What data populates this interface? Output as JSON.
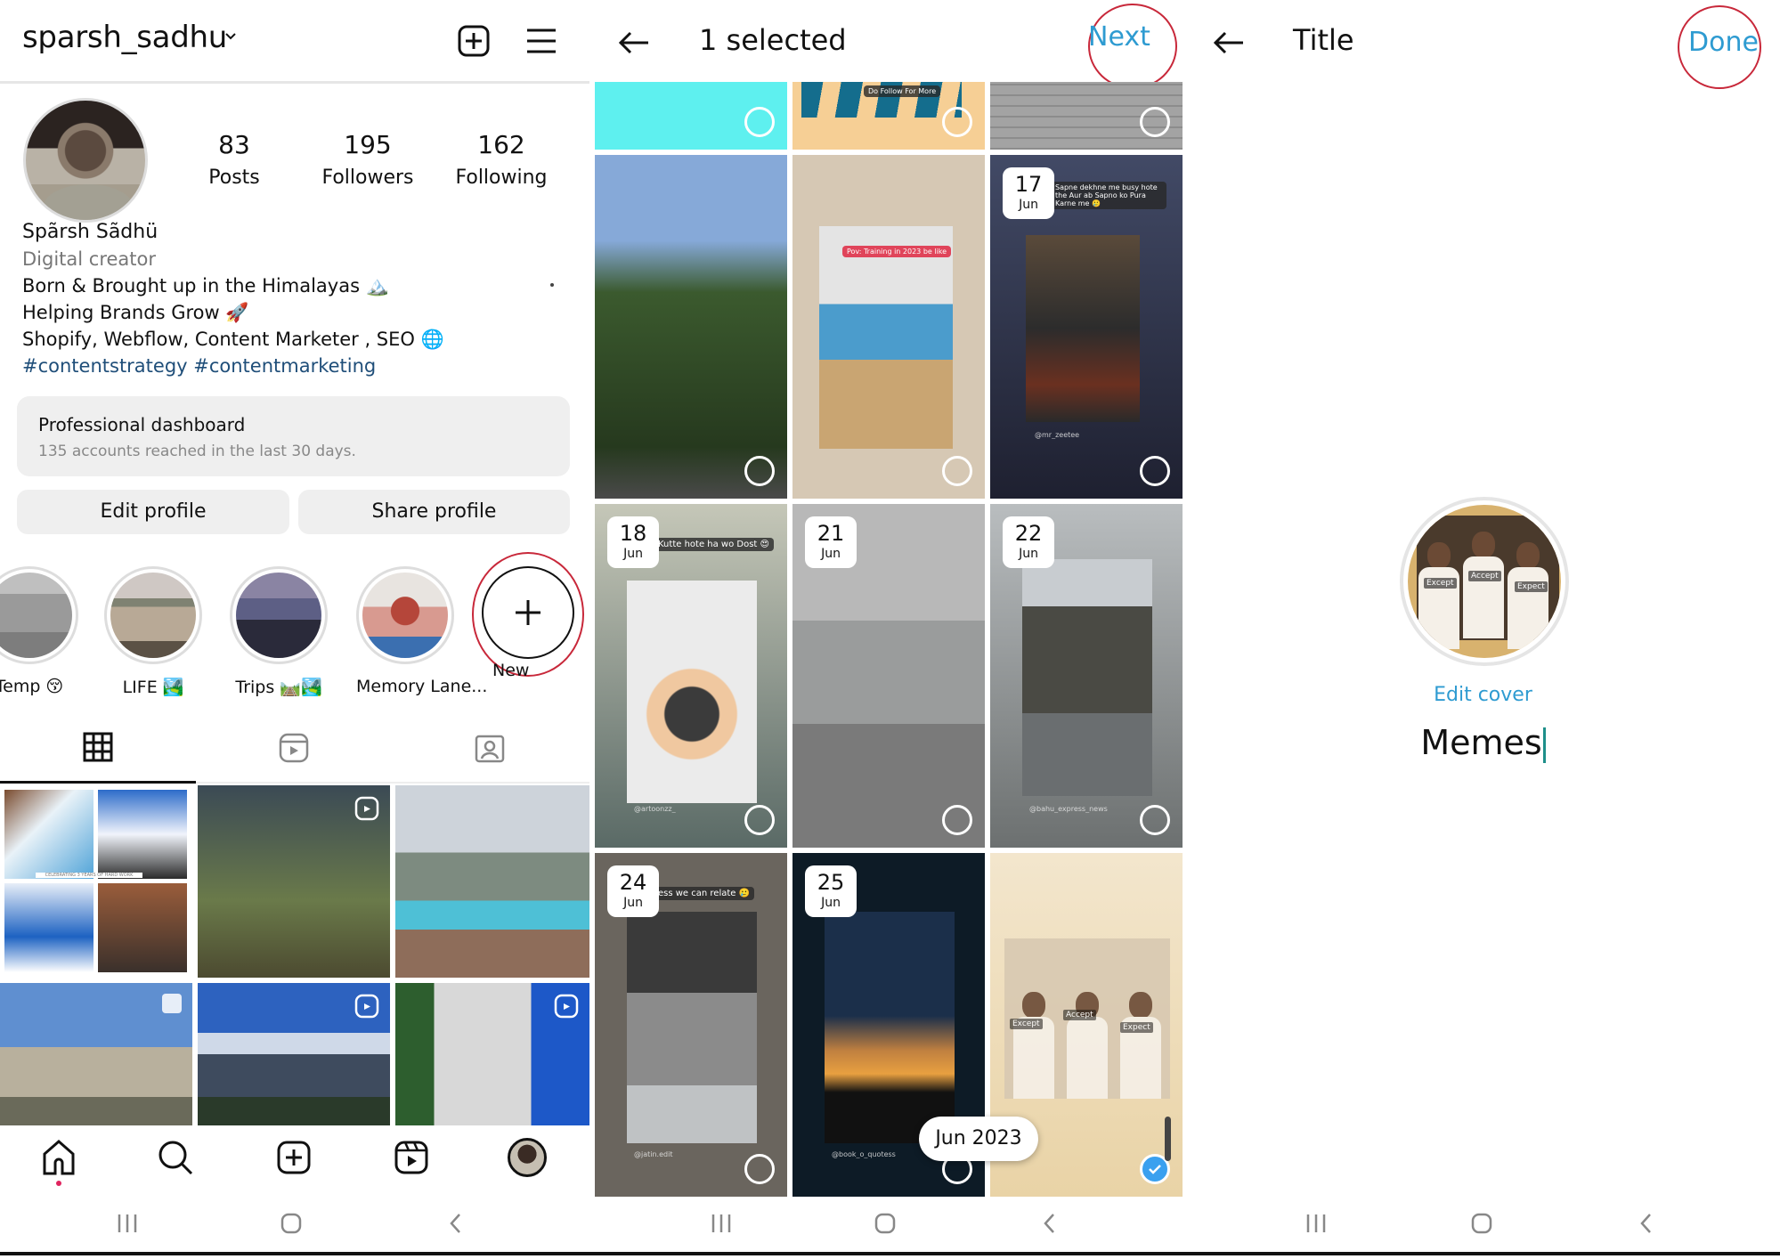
{
  "profile_screen": {
    "username": "sparsh_sadhu",
    "stats": [
      {
        "value": "83",
        "label": "Posts"
      },
      {
        "value": "195",
        "label": "Followers"
      },
      {
        "value": "162",
        "label": "Following"
      }
    ],
    "display_name": "Spãrsh Sãdhü",
    "category": "Digital creator",
    "bio_lines": [
      "Born & Brought up in the Himalayas 🏔️",
      "Helping Brands Grow 🚀",
      "Shopify, Webflow, Content Marketer , SEO 🌐"
    ],
    "hashtags": "#contentstrategy #contentmarketing",
    "dashboard": {
      "title": "Professional dashboard",
      "subtitle": "135 accounts reached in the last 30 days."
    },
    "buttons": {
      "edit": "Edit profile",
      "share": "Share profile"
    },
    "highlights": [
      {
        "label": "Temp 😚"
      },
      {
        "label": "LIFE 🏞️"
      },
      {
        "label": "Trips 🛤️🏞️"
      },
      {
        "label": "Memory Lane..."
      },
      {
        "label": "New"
      }
    ],
    "tabs": [
      "grid-icon",
      "reels-icon",
      "tagged-icon"
    ],
    "posts": [
      {
        "type": "collage",
        "caption": "CELEBRATING 3 YEARS OF HARD WORK"
      },
      {
        "type": "reel"
      },
      {
        "type": "photo"
      },
      {
        "type": "carousel"
      },
      {
        "type": "reel"
      },
      {
        "type": "reel"
      }
    ],
    "bottom_nav": [
      "home-icon",
      "search-icon",
      "create-icon",
      "reels-icon",
      "profile-avatar"
    ]
  },
  "select_screen": {
    "title": "1 selected",
    "next_label": "Next",
    "stories": [
      {
        "date_day": "",
        "date_month": "",
        "caption": "",
        "selected": false
      },
      {
        "date_day": "",
        "date_month": "",
        "caption": "Do Follow For More",
        "selected": false
      },
      {
        "date_day": "",
        "date_month": "",
        "caption": "",
        "selected": false
      },
      {
        "date_day": "",
        "date_month": "",
        "caption": "",
        "selected": false
      },
      {
        "date_day": "",
        "date_month": "",
        "caption": "Pov: Training in 2023 be like",
        "selected": false
      },
      {
        "date_day": "17",
        "date_month": "Jun",
        "caption": "Sapne dekhne me busy hote the Aur ab Sapno ko Pura Karne me 🥲",
        "handle": "@mr_zeetee",
        "selected": false
      },
      {
        "date_day": "18",
        "date_month": "Jun",
        "caption": "Kutte hote ha wo Dost 😍",
        "handle": "@artoonzz_",
        "selected": false
      },
      {
        "date_day": "21",
        "date_month": "Jun",
        "caption": "",
        "selected": false
      },
      {
        "date_day": "22",
        "date_month": "Jun",
        "caption": "",
        "handle": "@bahu_express_news",
        "selected": false
      },
      {
        "date_day": "24",
        "date_month": "Jun",
        "caption": "ess we can relate 🥲",
        "handle": "@jatin.edit",
        "selected": false
      },
      {
        "date_day": "25",
        "date_month": "Jun",
        "caption": "",
        "handle": "@book_o_quotess",
        "selected": false
      },
      {
        "date_day": "",
        "date_month": "",
        "caption": "",
        "labels": [
          "Except",
          "Accept",
          "Expect"
        ],
        "selected": true
      }
    ],
    "month_indicator": "Jun 2023"
  },
  "title_screen": {
    "title": "Title",
    "done_label": "Done",
    "edit_cover_label": "Edit cover",
    "highlight_title_value": "Memes",
    "cover_labels": [
      "Except",
      "Accept",
      "Expect"
    ]
  },
  "colors": {
    "accent_blue": "#2e9bd1",
    "annotation_red": "#c8283a",
    "hashtag": "#1f4e79",
    "check_blue": "#3aa0ef"
  }
}
